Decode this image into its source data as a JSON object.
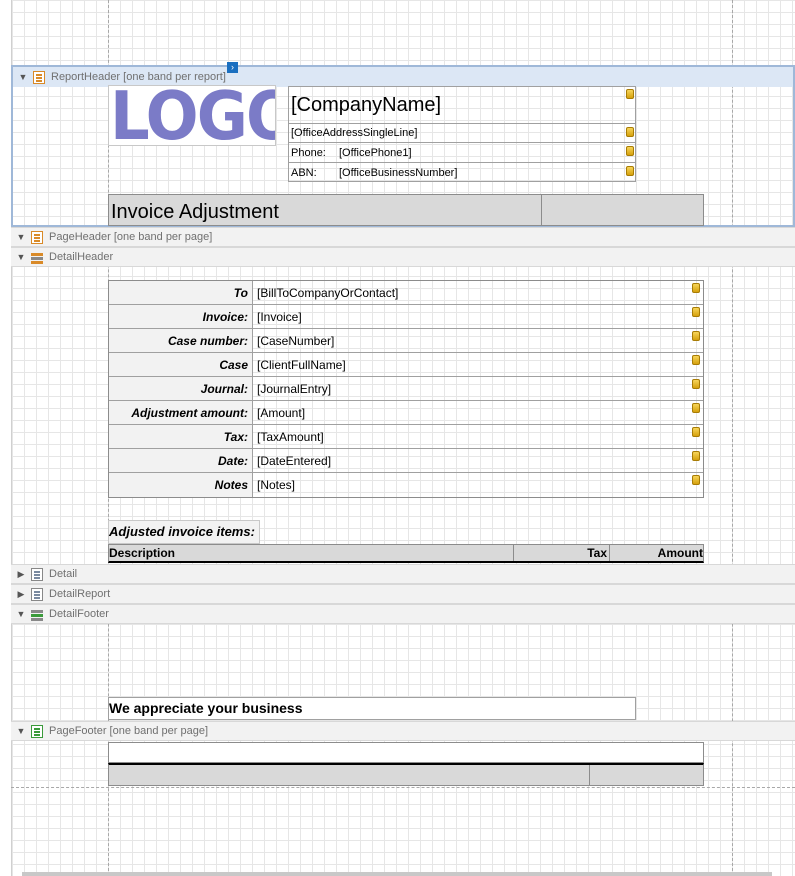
{
  "bands": {
    "report_header": "ReportHeader [one band per report]",
    "page_header": "PageHeader [one band per page]",
    "detail_header": "DetailHeader",
    "detail": "Detail",
    "detail_report": "DetailReport",
    "detail_footer": "DetailFooter",
    "page_footer": "PageFooter [one band per page]"
  },
  "header": {
    "logo_text": "LOGO",
    "company_name": "[CompanyName]",
    "office_address": "[OfficeAddressSingleLine]",
    "phone_label": "Phone:",
    "phone_value": "[OfficePhone1]",
    "abn_label": "ABN:",
    "abn_value": "[OfficeBusinessNumber]",
    "title": "Invoice Adjustment"
  },
  "details": [
    {
      "label": "To",
      "value": "[BillToCompanyOrContact]"
    },
    {
      "label": "Invoice:",
      "value": "[Invoice]"
    },
    {
      "label": "Case number:",
      "value": "[CaseNumber]"
    },
    {
      "label": "Case",
      "value": "[ClientFullName]"
    },
    {
      "label": "Journal:",
      "value": "[JournalEntry]"
    },
    {
      "label": "Adjustment amount:",
      "value": "[Amount]"
    },
    {
      "label": "Tax:",
      "value": "[TaxAmount]"
    },
    {
      "label": "Date:",
      "value": "[DateEntered]"
    },
    {
      "label": "Notes",
      "value": "[Notes]"
    }
  ],
  "items": {
    "section_label": "Adjusted invoice items:",
    "col_description": "Description",
    "col_tax": "Tax",
    "col_amount": "Amount"
  },
  "footer": {
    "appreciation": "We appreciate your business"
  },
  "colors": {
    "logo": "#7b7bc7",
    "selection": "#9fb8d8",
    "field_fill": "#d9d9d9"
  }
}
